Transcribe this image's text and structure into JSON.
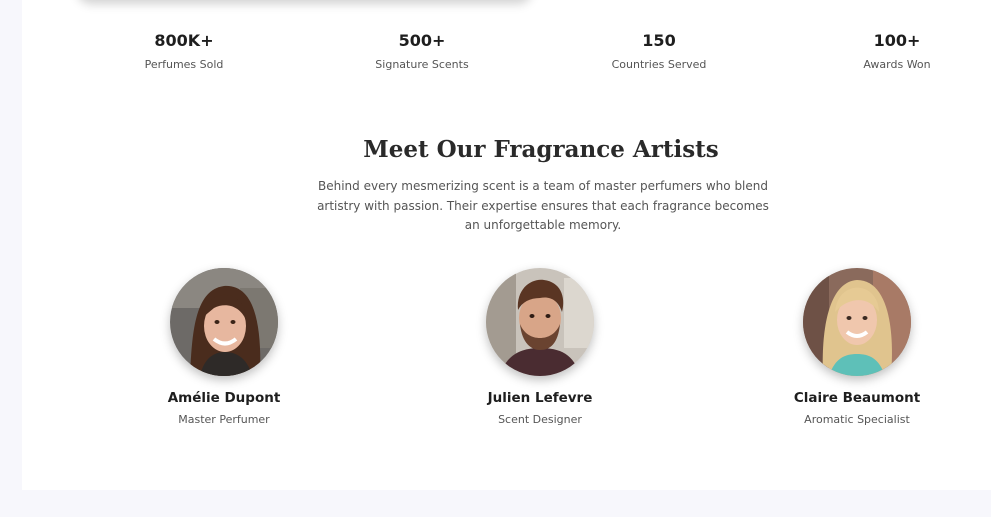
{
  "stats": [
    {
      "value": "800K+",
      "label": "Perfumes Sold"
    },
    {
      "value": "500+",
      "label": "Signature Scents"
    },
    {
      "value": "150",
      "label": "Countries Served"
    },
    {
      "value": "100+",
      "label": "Awards Won"
    }
  ],
  "artists_section": {
    "title": "Meet Our Fragrance Artists",
    "description": "Behind every mesmerizing scent is a team of master perfumers who blend artistry with passion. Their expertise ensures that each fragrance becomes an unforgettable memory."
  },
  "artists": [
    {
      "name": "Amélie Dupont",
      "role": "Master Perfumer"
    },
    {
      "name": "Julien Lefevre",
      "role": "Scent Designer"
    },
    {
      "name": "Claire Beaumont",
      "role": "Aromatic Specialist"
    }
  ],
  "colors": {
    "page_background": "#f7f7fc",
    "content_background": "#ffffff",
    "heading": "#2a2a2a",
    "muted_text": "#555555"
  }
}
